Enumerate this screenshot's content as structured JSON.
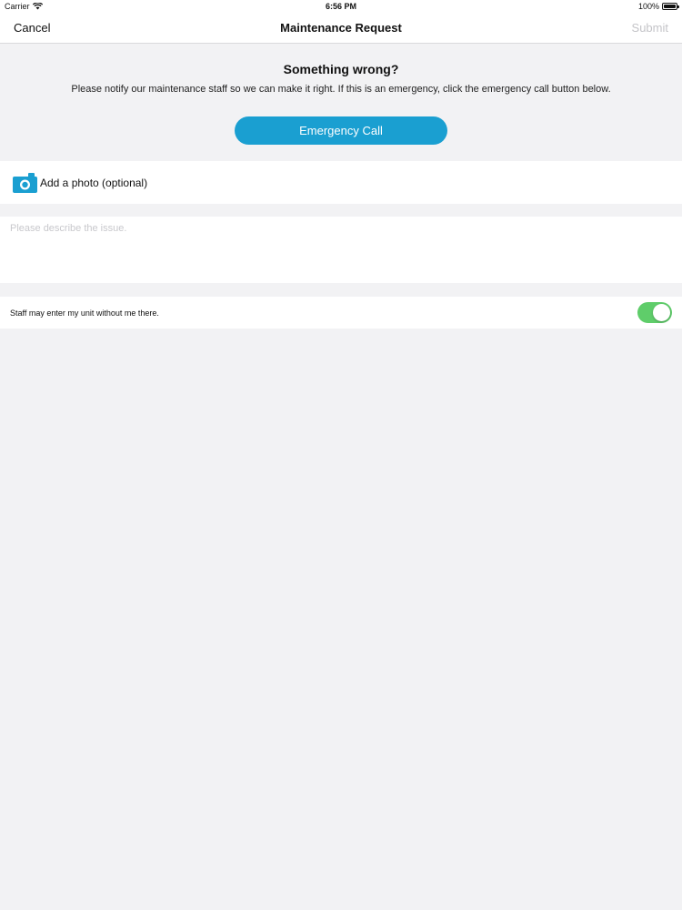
{
  "status_bar": {
    "carrier": "Carrier",
    "time": "6:56 PM",
    "battery": "100%",
    "battery_level": 1.0
  },
  "nav": {
    "cancel_label": "Cancel",
    "title": "Maintenance Request",
    "submit_label": "Submit"
  },
  "intro": {
    "heading": "Something wrong?",
    "text": "Please notify our maintenance staff so we can make it right. If this is an emergency, click the emergency call button below.",
    "emergency_label": "Emergency Call"
  },
  "photo": {
    "label": "Add a photo (optional)",
    "icon": "camera-icon"
  },
  "description": {
    "placeholder": "Please describe the issue.",
    "value": ""
  },
  "entry_permission": {
    "label": "Staff may enter my unit without me there.",
    "enabled": true
  },
  "colors": {
    "accent": "#1a9fd1",
    "toggle_on": "#5fcd6a",
    "background": "#f2f2f4"
  }
}
